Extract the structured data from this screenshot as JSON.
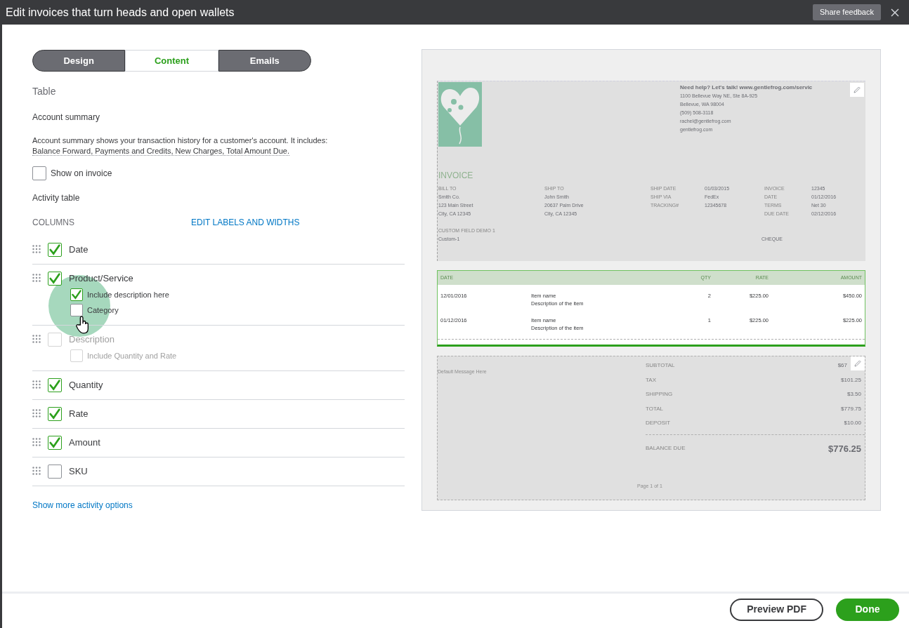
{
  "window": {
    "title": "Edit invoices that turn heads and open wallets",
    "feedback_button": "Share feedback"
  },
  "tabs": [
    {
      "label": "Design",
      "selected": false
    },
    {
      "label": "Content",
      "selected": true
    },
    {
      "label": "Emails",
      "selected": false
    }
  ],
  "section_title": "Table",
  "account_summary": {
    "heading": "Account summary",
    "description": "Account summary shows your transaction history for a customer's account. It includes:",
    "terms_line": "Balance Forward, Payments and Credits, New Charges, Total Amount Due.",
    "show_on_invoice": {
      "label": "Show on invoice",
      "checked": false
    }
  },
  "activity_table": {
    "heading": "Activity table",
    "columns_label": "COLUMNS",
    "edit_link": "EDIT LABELS AND WIDTHS",
    "columns": [
      {
        "label": "Date",
        "checked": true,
        "disabled": false
      },
      {
        "label": "Product/Service",
        "checked": true,
        "disabled": false,
        "children": [
          {
            "label": "Include description here",
            "checked": true,
            "disabled": false
          },
          {
            "label": "Category",
            "checked": false,
            "disabled": false
          }
        ]
      },
      {
        "label": "Description",
        "checked": false,
        "disabled": true,
        "children": [
          {
            "label": "Include Quantity and Rate",
            "checked": false,
            "disabled": true
          }
        ]
      },
      {
        "label": "Quantity",
        "checked": true,
        "disabled": false
      },
      {
        "label": "Rate",
        "checked": true,
        "disabled": false
      },
      {
        "label": "Amount",
        "checked": true,
        "disabled": false
      },
      {
        "label": "SKU",
        "checked": false,
        "disabled": false
      }
    ],
    "more_link": "Show more activity options"
  },
  "preview": {
    "company": {
      "headline": "Need help? Let's talk! www.gentlefrog.com/servic",
      "lines": [
        "1100 Bellevue Way NE, Ste 8A-925",
        "Bellevue, WA 98004",
        "(509) 508-3118",
        "rachel@gentlefrog.com",
        "gentlefrog.com"
      ]
    },
    "invoice_title": "INVOICE",
    "bill_to": {
      "label": "BILL TO",
      "lines": [
        "Smith Co.",
        "123 Main Street",
        "City, CA 12345"
      ]
    },
    "ship_to": {
      "label": "SHIP TO",
      "lines": [
        "John Smith",
        "20637 Palm Drive",
        "City, CA 12345"
      ]
    },
    "ship_fields": [
      {
        "label": "SHIP DATE",
        "value": "01/03/2015"
      },
      {
        "label": "SHIP VIA",
        "value": "FedEx"
      },
      {
        "label": "TRACKING#",
        "value": "12345678"
      }
    ],
    "invoice_fields": [
      {
        "label": "INVOICE",
        "value": "12345"
      },
      {
        "label": "DATE",
        "value": "01/12/2016"
      },
      {
        "label": "TERMS",
        "value": "Net 30"
      },
      {
        "label": "DUE DATE",
        "value": "02/12/2016"
      }
    ],
    "custom_field": {
      "label": "CUSTOM FIELD DEMO 1",
      "value": "Custom-1"
    },
    "payment_method": "CHEQUE",
    "table": {
      "columns": [
        "DATE",
        "QTY",
        "RATE",
        "AMOUNT"
      ],
      "rows": [
        {
          "date": "12/01/2016",
          "item": "Item name",
          "description": "Description of the item",
          "qty": "2",
          "rate": "$225.00",
          "amount": "$450.00"
        },
        {
          "date": "01/12/2016",
          "item": "Item name",
          "description": "Description of the item",
          "qty": "1",
          "rate": "$225.00",
          "amount": "$225.00"
        }
      ]
    },
    "message": "Default Message Here",
    "totals": [
      {
        "label": "SUBTOTAL",
        "value": "$67"
      },
      {
        "label": "TAX",
        "value": "$101.25"
      },
      {
        "label": "SHIPPING",
        "value": "$3.50"
      },
      {
        "label": "TOTAL",
        "value": "$779.75"
      },
      {
        "label": "DEPOSIT",
        "value": "$10.00"
      }
    ],
    "balance": {
      "label": "BALANCE DUE",
      "value": "$776.25"
    },
    "page": "Page 1 of 1"
  },
  "footer": {
    "preview_button": "Preview PDF",
    "done_button": "Done"
  }
}
